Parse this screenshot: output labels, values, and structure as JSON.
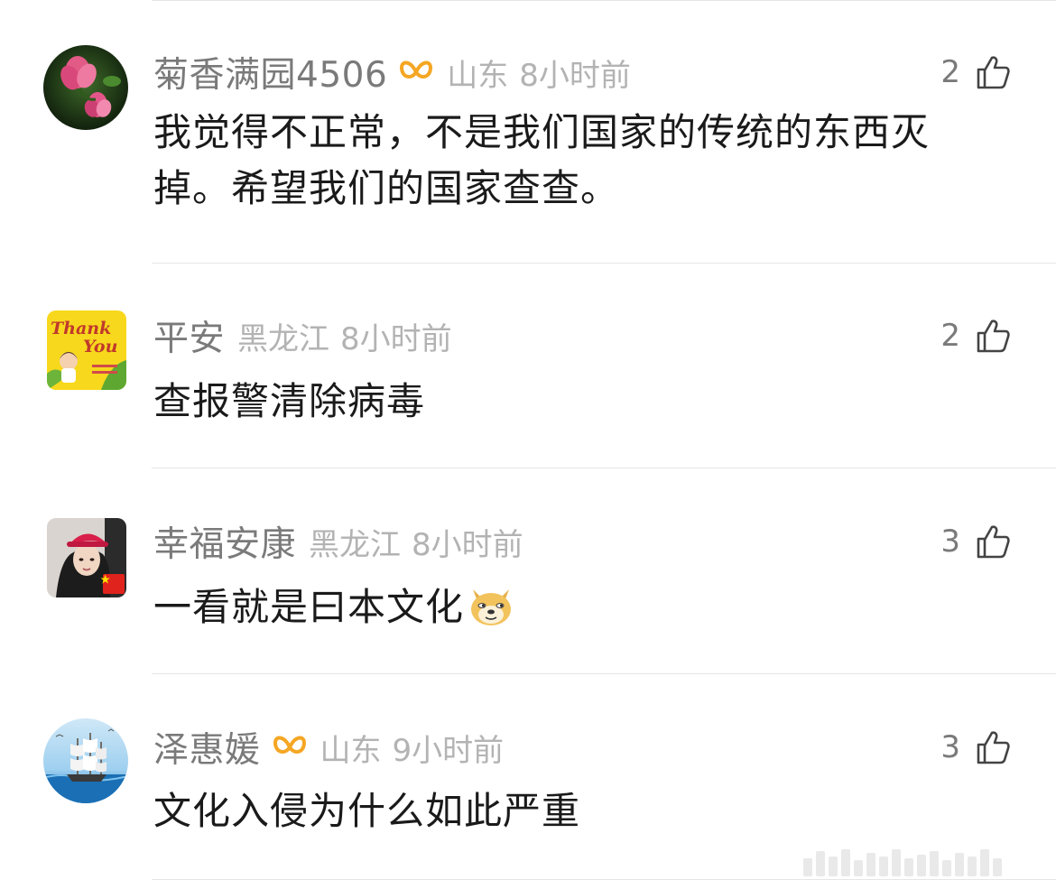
{
  "comments": [
    {
      "username": "菊香满园4506",
      "vip": true,
      "location": "山东",
      "time": "8小时前",
      "likes": "2",
      "content": "我觉得不正常，不是我们国家的传统的东西灭掉。希望我们的国家查查。",
      "avatar_icon": "lotus-flower-avatar"
    },
    {
      "username": "平安",
      "vip": false,
      "location": "黑龙江",
      "time": "8小时前",
      "likes": "2",
      "content": "查报警清除病毒",
      "avatar_icon": "thank-you-card-avatar",
      "avatar_text": {
        "line1": "Thank",
        "line2": "You"
      }
    },
    {
      "username": "幸福安康",
      "vip": false,
      "location": "黑龙江",
      "time": "8小时前",
      "likes": "3",
      "content": "一看就是曰本文化",
      "avatar_icon": "woman-red-cap-avatar",
      "emoji": "doge-emoji"
    },
    {
      "username": "泽惠媛",
      "vip": true,
      "location": "山东",
      "time": "9小时前",
      "likes": "3",
      "content": "文化入侵为什么如此严重",
      "avatar_icon": "sailing-ship-avatar"
    }
  ],
  "colors": {
    "username": "#7a7a7a",
    "meta": "#b3b3b3",
    "content": "#1a1a1a",
    "vip_orange": "#f5a623",
    "divider": "#e6e6e6"
  }
}
